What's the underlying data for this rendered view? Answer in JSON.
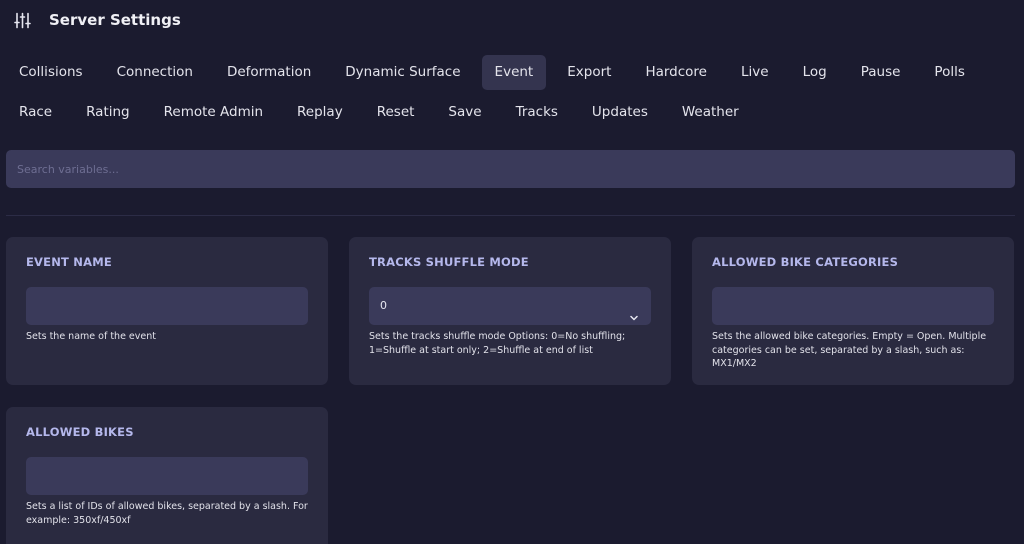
{
  "header": {
    "icon": "sliders-icon",
    "title": "Server Settings"
  },
  "tabs": [
    {
      "label": "Collisions",
      "active": false
    },
    {
      "label": "Connection",
      "active": false
    },
    {
      "label": "Deformation",
      "active": false
    },
    {
      "label": "Dynamic Surface",
      "active": false
    },
    {
      "label": "Event",
      "active": true
    },
    {
      "label": "Export",
      "active": false
    },
    {
      "label": "Hardcore",
      "active": false
    },
    {
      "label": "Live",
      "active": false
    },
    {
      "label": "Log",
      "active": false
    },
    {
      "label": "Pause",
      "active": false
    },
    {
      "label": "Polls",
      "active": false
    },
    {
      "label": "Race",
      "active": false
    },
    {
      "label": "Rating",
      "active": false
    },
    {
      "label": "Remote Admin",
      "active": false
    },
    {
      "label": "Replay",
      "active": false
    },
    {
      "label": "Reset",
      "active": false
    },
    {
      "label": "Save",
      "active": false
    },
    {
      "label": "Tracks",
      "active": false
    },
    {
      "label": "Updates",
      "active": false
    },
    {
      "label": "Weather",
      "active": false
    }
  ],
  "search": {
    "placeholder": "Search variables...",
    "value": ""
  },
  "settings": [
    {
      "label": "EVENT NAME",
      "type": "text",
      "value": "",
      "description": "Sets the name of the event"
    },
    {
      "label": "TRACKS SHUFFLE MODE",
      "type": "select",
      "value": "0",
      "description": "Sets the tracks shuffle mode Options: 0=No shuffling; 1=Shuffle at start only; 2=Shuffle at end of list"
    },
    {
      "label": "ALLOWED BIKE CATEGORIES",
      "type": "text",
      "value": "",
      "description": "Sets the allowed bike categories. Empty = Open. Multiple categories can be set, separated by a slash, such as: MX1/MX2"
    },
    {
      "label": "ALLOWED BIKES",
      "type": "text",
      "value": "",
      "description": "Sets a list of IDs of allowed bikes, separated by a slash. For example: 350xf/450xf"
    }
  ],
  "colors": {
    "background": "#1b1b2f",
    "card": "#2a2a40",
    "field": "#3a3a5a",
    "active_tab": "#34344f",
    "label_accent": "#b5b8ec"
  }
}
